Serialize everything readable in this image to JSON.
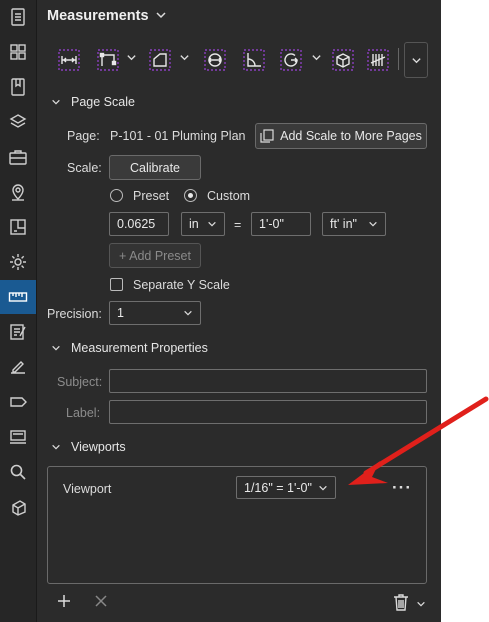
{
  "panel": {
    "title": "Measurements"
  },
  "icons": {
    "rail": [
      "document-icon",
      "grid-icon",
      "bookmark-icon",
      "layers-icon",
      "toolbox-icon",
      "location-pin-icon",
      "page-split-icon",
      "gear-icon",
      "ruler-icon",
      "markup-list-icon",
      "signature-icon",
      "tag-icon",
      "stamp-icon",
      "search-icon",
      "shape-3d-icon"
    ],
    "toolbar": [
      "length-measure-icon",
      "polylength-measure-icon",
      "area-measure-icon",
      "diameter-measure-icon",
      "angle-measure-icon",
      "radius-measure-icon",
      "volume-measure-icon",
      "count-measure-icon"
    ]
  },
  "page_scale": {
    "header": "Page Scale",
    "page_label": "Page:",
    "page_value": "P-101 - 01 Pluming Plan",
    "add_scale_button": "Add Scale to More Pages",
    "scale_label": "Scale:",
    "calibrate_button": "Calibrate",
    "preset_option": "Preset",
    "custom_option": "Custom",
    "selected_option": "Custom",
    "value_left": "0.0625",
    "unit_left": "in",
    "equals": "=",
    "value_right": "1'-0\"",
    "unit_right": "ft' in\"",
    "add_preset_button": "+ Add Preset",
    "separate_y_label": "Separate Y Scale",
    "separate_y_checked": false,
    "precision_label": "Precision:",
    "precision_value": "1"
  },
  "measurement_properties": {
    "header": "Measurement Properties",
    "subject_label": "Subject:",
    "subject_value": "",
    "label_label": "Label:",
    "label_value": ""
  },
  "viewports": {
    "header": "Viewports",
    "item_label": "Viewport",
    "scale_value": "1/16\" = 1'-0\"",
    "more": "···"
  },
  "colors": {
    "accent": "#1a5a92",
    "annotation_arrow": "#e0201b",
    "toolbar_purple": "#8a3fbf"
  }
}
